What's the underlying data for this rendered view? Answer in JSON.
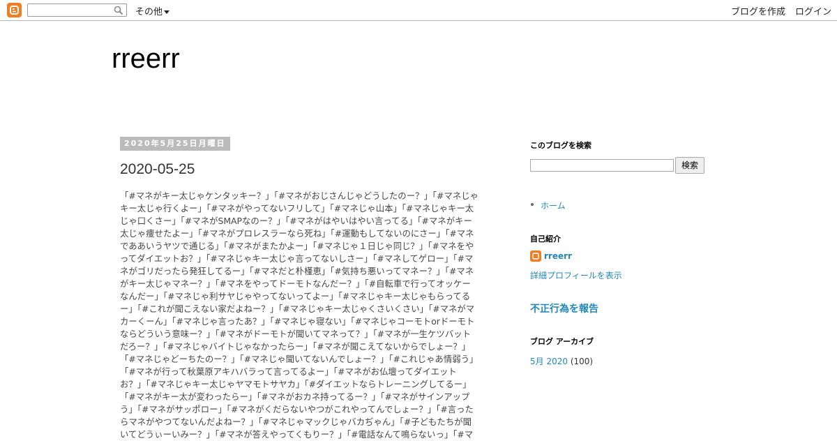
{
  "navbar": {
    "more_label": "その他",
    "create_label": "ブログを作成",
    "login_label": "ログイン",
    "search_value": ""
  },
  "header": {
    "title": "rreerr"
  },
  "post": {
    "date": "2020年5月25日月曜日",
    "title": "2020-05-25",
    "lines": [
      "「#マネがキー太じゃケンタッキー？」「#マネがおじさんじゃどうしたのー？」「#マネじゃ",
      "キー太じゃ行くよー」「#マネがやってないフリして」「#マネじゃ山本」「#マネじゃキー太",
      "じゃ口くさー」「#マネがSMAPなのー？」「#マネがはやいはやい言ってる」「#マネがキー",
      "太じゃ痩せたよー」「#マネがプロレスラーなら死ね」「#運動もしてないのにさー」「#マネ",
      "でああいうヤツで通じる」「#マネがまたかよー」「#マネじゃ１日じゃ同じ？」「#マネをや",
      "ってダイエットお？」「#マネじゃキー太じゃ言ってないしさー」「#マネしてゲロー」「#マ",
      "ネがゴリだったら発狂してるー」「#マネだと朴槿恵」「#気持ち悪いってマネー？」「#マネ",
      "がキー太じゃマネー？」「#マネをやってドーモトなんだー？」「#自転車で行ってオッケー",
      "なんだー」「#マネじゃ利サヤじゃやってないってよー」「#マネじゃキー太じゃもらってる",
      "ー」「#これが聞こえない家だよねー？」「#マネじゃキー太じゃくさいくさい」「#マネがマ",
      "カーくーん」「#マネじゃ言ったあ？」「#マネじゃ寝ない」「#マネじゃコーモトorドーモト",
      "ならどういう意味ー？」「#マネがドーモトが聞いてマネって？」「#マネが一生ケツバット",
      "だろー？」「#マネじゃバイトじゃなかったらー」「#マネが聞こえてないからでしょー？」",
      "「#マネじゃどーちたのー？」「#マネじゃ聞いてないんでしょー？」「#これじゃあ情弱う」",
      "「#マネが行って秋葉原アキハバラって言ってるよー」「#マネがお仏壇ってダイエット",
      "お？」「#マネじゃキー太じゃヤマモトサヤカ」「#ダイエットならトレーニングしてるー」",
      "「#マネがキー太が変わったらー」「#マネがおカネ持ってるー？」「#マネがサインアップ",
      "う」「#マネがサッポロー」「#マネがくだらないやつがこれやってんでしょー？」「#言った",
      "らマネがやつてないんだよねー？」「#マネじゃマックじゃバカぢゃん」「#子どもたちが聞",
      "いてどうぃーいみー？」「#マネが答えやってくもりー？」「#電話なんて鳴らないっ」「#マ"
    ]
  },
  "sidebar": {
    "search_heading": "このブログを検索",
    "search_button": "検索",
    "pages": [
      "ホーム"
    ],
    "profile_heading": "自己紹介",
    "profile_name": "rreerr",
    "profile_link": "詳細プロフィールを表示",
    "report_label": "不正行為を報告",
    "archive_heading": "ブログ アーカイブ",
    "archive_month": "5月 2020",
    "archive_count": "(100)"
  }
}
